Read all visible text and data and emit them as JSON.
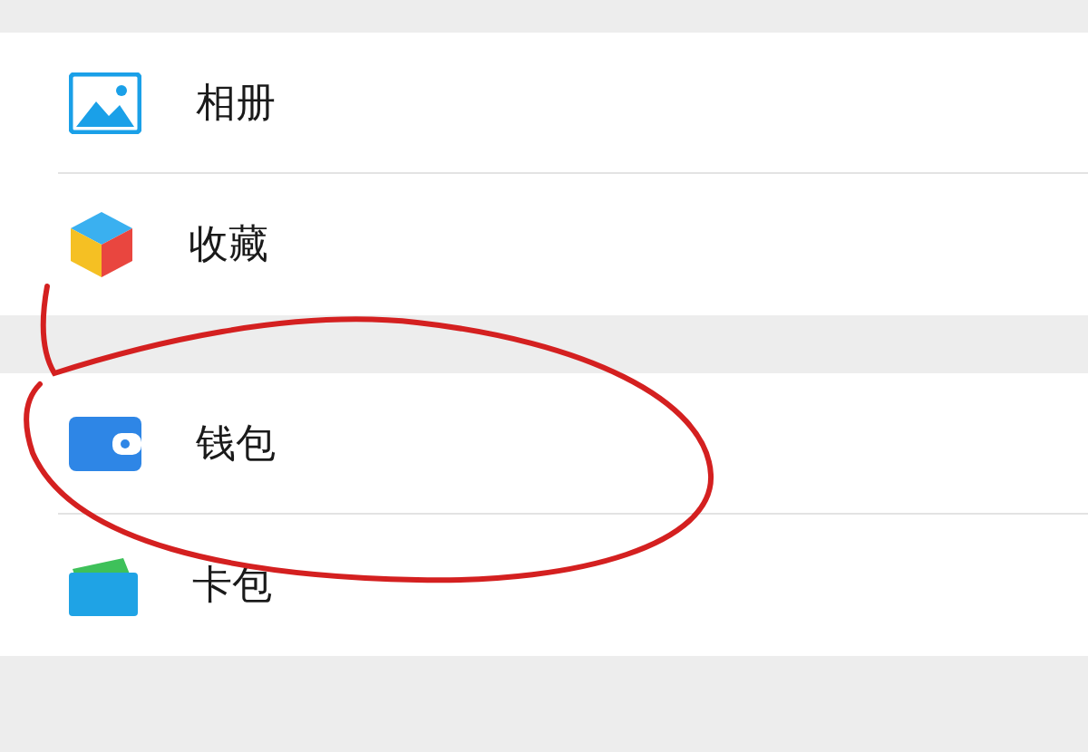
{
  "groups": [
    {
      "items": [
        {
          "label": "相册",
          "kind": "album"
        },
        {
          "label": "收藏",
          "kind": "favorites"
        }
      ]
    },
    {
      "items": [
        {
          "label": "钱包",
          "kind": "wallet"
        },
        {
          "label": "卡包",
          "kind": "cards"
        }
      ]
    }
  ],
  "annotation": {
    "kind": "freehand-circle"
  }
}
